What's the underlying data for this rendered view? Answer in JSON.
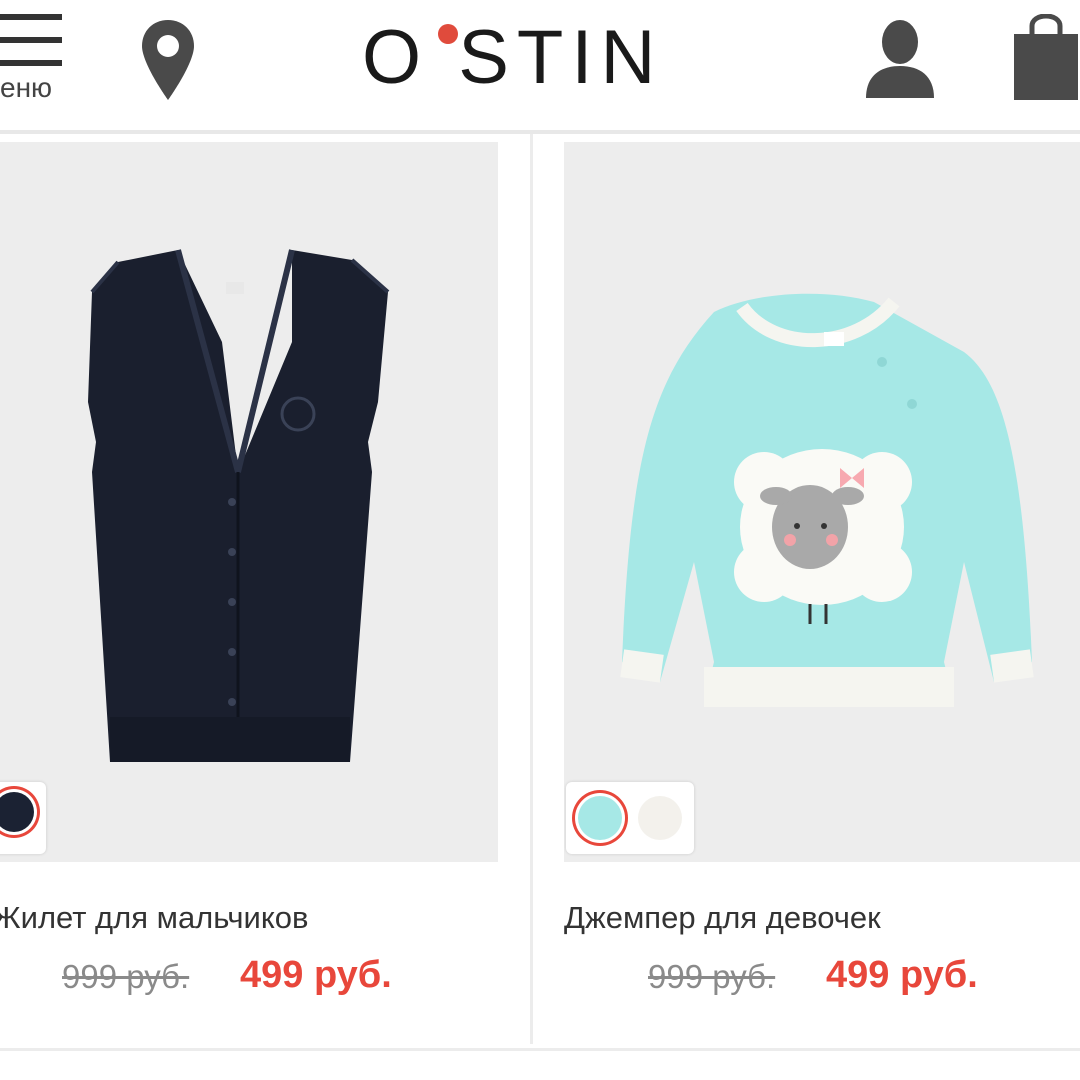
{
  "header": {
    "menu_label": "еню",
    "logo_text": "O STIN",
    "brand_accent": "#e04b3c",
    "icons": [
      "menu-icon",
      "location-pin-icon",
      "user-icon",
      "shopping-bag-icon"
    ]
  },
  "products": [
    {
      "title": "Жилет для мальчиков",
      "old_price": "999 руб.",
      "new_price": "499 руб.",
      "swatches": [
        {
          "color": "#1b2233",
          "selected": true
        }
      ]
    },
    {
      "title": "Джемпер для девочек",
      "old_price": "999 руб.",
      "new_price": "499 руб.",
      "swatches": [
        {
          "color": "#a6e8e6",
          "selected": true
        },
        {
          "color": "#f3f1ec",
          "selected": false
        }
      ]
    }
  ],
  "colors": {
    "price_red": "#e8473b",
    "text": "#333333"
  }
}
